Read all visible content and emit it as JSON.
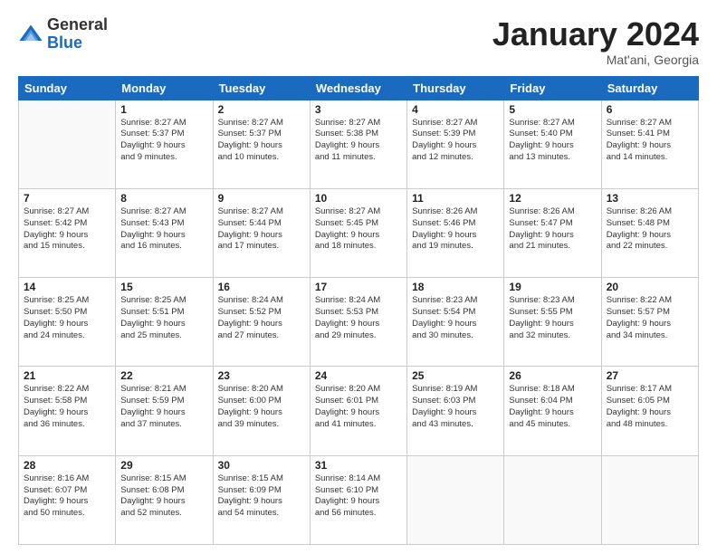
{
  "logo": {
    "general": "General",
    "blue": "Blue"
  },
  "header": {
    "month": "January 2024",
    "location": "Mat'ani, Georgia"
  },
  "weekdays": [
    "Sunday",
    "Monday",
    "Tuesday",
    "Wednesday",
    "Thursday",
    "Friday",
    "Saturday"
  ],
  "weeks": [
    [
      {
        "day": "",
        "info": ""
      },
      {
        "day": "1",
        "info": "Sunrise: 8:27 AM\nSunset: 5:37 PM\nDaylight: 9 hours\nand 9 minutes."
      },
      {
        "day": "2",
        "info": "Sunrise: 8:27 AM\nSunset: 5:37 PM\nDaylight: 9 hours\nand 10 minutes."
      },
      {
        "day": "3",
        "info": "Sunrise: 8:27 AM\nSunset: 5:38 PM\nDaylight: 9 hours\nand 11 minutes."
      },
      {
        "day": "4",
        "info": "Sunrise: 8:27 AM\nSunset: 5:39 PM\nDaylight: 9 hours\nand 12 minutes."
      },
      {
        "day": "5",
        "info": "Sunrise: 8:27 AM\nSunset: 5:40 PM\nDaylight: 9 hours\nand 13 minutes."
      },
      {
        "day": "6",
        "info": "Sunrise: 8:27 AM\nSunset: 5:41 PM\nDaylight: 9 hours\nand 14 minutes."
      }
    ],
    [
      {
        "day": "7",
        "info": "Sunrise: 8:27 AM\nSunset: 5:42 PM\nDaylight: 9 hours\nand 15 minutes."
      },
      {
        "day": "8",
        "info": "Sunrise: 8:27 AM\nSunset: 5:43 PM\nDaylight: 9 hours\nand 16 minutes."
      },
      {
        "day": "9",
        "info": "Sunrise: 8:27 AM\nSunset: 5:44 PM\nDaylight: 9 hours\nand 17 minutes."
      },
      {
        "day": "10",
        "info": "Sunrise: 8:27 AM\nSunset: 5:45 PM\nDaylight: 9 hours\nand 18 minutes."
      },
      {
        "day": "11",
        "info": "Sunrise: 8:26 AM\nSunset: 5:46 PM\nDaylight: 9 hours\nand 19 minutes."
      },
      {
        "day": "12",
        "info": "Sunrise: 8:26 AM\nSunset: 5:47 PM\nDaylight: 9 hours\nand 21 minutes."
      },
      {
        "day": "13",
        "info": "Sunrise: 8:26 AM\nSunset: 5:48 PM\nDaylight: 9 hours\nand 22 minutes."
      }
    ],
    [
      {
        "day": "14",
        "info": "Sunrise: 8:25 AM\nSunset: 5:50 PM\nDaylight: 9 hours\nand 24 minutes."
      },
      {
        "day": "15",
        "info": "Sunrise: 8:25 AM\nSunset: 5:51 PM\nDaylight: 9 hours\nand 25 minutes."
      },
      {
        "day": "16",
        "info": "Sunrise: 8:24 AM\nSunset: 5:52 PM\nDaylight: 9 hours\nand 27 minutes."
      },
      {
        "day": "17",
        "info": "Sunrise: 8:24 AM\nSunset: 5:53 PM\nDaylight: 9 hours\nand 29 minutes."
      },
      {
        "day": "18",
        "info": "Sunrise: 8:23 AM\nSunset: 5:54 PM\nDaylight: 9 hours\nand 30 minutes."
      },
      {
        "day": "19",
        "info": "Sunrise: 8:23 AM\nSunset: 5:55 PM\nDaylight: 9 hours\nand 32 minutes."
      },
      {
        "day": "20",
        "info": "Sunrise: 8:22 AM\nSunset: 5:57 PM\nDaylight: 9 hours\nand 34 minutes."
      }
    ],
    [
      {
        "day": "21",
        "info": "Sunrise: 8:22 AM\nSunset: 5:58 PM\nDaylight: 9 hours\nand 36 minutes."
      },
      {
        "day": "22",
        "info": "Sunrise: 8:21 AM\nSunset: 5:59 PM\nDaylight: 9 hours\nand 37 minutes."
      },
      {
        "day": "23",
        "info": "Sunrise: 8:20 AM\nSunset: 6:00 PM\nDaylight: 9 hours\nand 39 minutes."
      },
      {
        "day": "24",
        "info": "Sunrise: 8:20 AM\nSunset: 6:01 PM\nDaylight: 9 hours\nand 41 minutes."
      },
      {
        "day": "25",
        "info": "Sunrise: 8:19 AM\nSunset: 6:03 PM\nDaylight: 9 hours\nand 43 minutes."
      },
      {
        "day": "26",
        "info": "Sunrise: 8:18 AM\nSunset: 6:04 PM\nDaylight: 9 hours\nand 45 minutes."
      },
      {
        "day": "27",
        "info": "Sunrise: 8:17 AM\nSunset: 6:05 PM\nDaylight: 9 hours\nand 48 minutes."
      }
    ],
    [
      {
        "day": "28",
        "info": "Sunrise: 8:16 AM\nSunset: 6:07 PM\nDaylight: 9 hours\nand 50 minutes."
      },
      {
        "day": "29",
        "info": "Sunrise: 8:15 AM\nSunset: 6:08 PM\nDaylight: 9 hours\nand 52 minutes."
      },
      {
        "day": "30",
        "info": "Sunrise: 8:15 AM\nSunset: 6:09 PM\nDaylight: 9 hours\nand 54 minutes."
      },
      {
        "day": "31",
        "info": "Sunrise: 8:14 AM\nSunset: 6:10 PM\nDaylight: 9 hours\nand 56 minutes."
      },
      {
        "day": "",
        "info": ""
      },
      {
        "day": "",
        "info": ""
      },
      {
        "day": "",
        "info": ""
      }
    ]
  ]
}
